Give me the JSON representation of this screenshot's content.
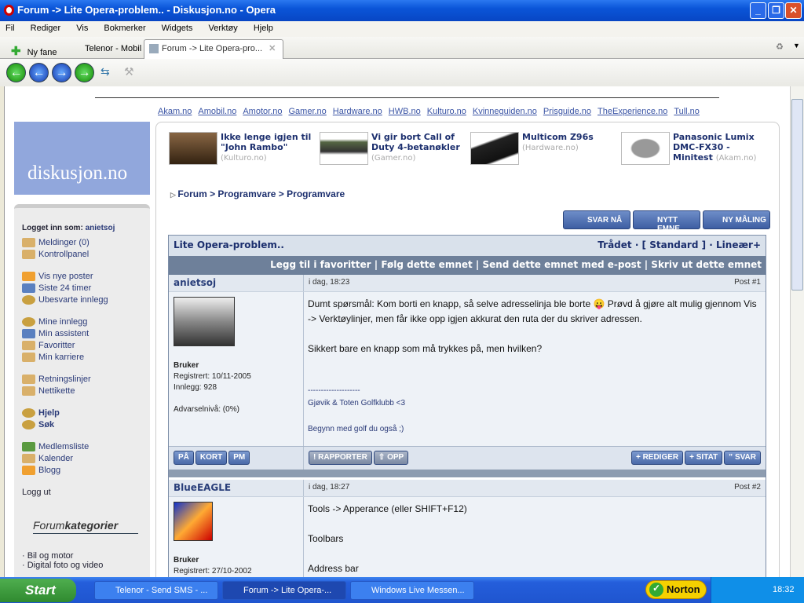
{
  "window": {
    "title": "Forum -> Lite Opera-problem.. - Diskusjon.no - Opera"
  },
  "menu": [
    "Fil",
    "Rediger",
    "Vis",
    "Bokmerker",
    "Widgets",
    "Verktøy",
    "Hjelp"
  ],
  "tabs": {
    "new_tab": "Ny fane",
    "tab1": "Telenor - Mobil",
    "tab2": "Forum -> Lite Opera-pro..."
  },
  "sitelinks": [
    "Akam.no",
    "Amobil.no",
    "Amotor.no",
    "Gamer.no",
    "Hardware.no",
    "HWB.no",
    "Kulturo.no",
    "Kvinneguiden.no",
    "Prisguide.no",
    "TheExperience.no",
    "Tull.no"
  ],
  "logo": "diskusjon.no",
  "news": [
    {
      "title": "Ikke lenge igjen til \"John Rambo\"",
      "source": "(Kulturo.no)"
    },
    {
      "title": "Vi gir bort Call of Duty 4-betanøkler",
      "source": "(Gamer.no)"
    },
    {
      "title": "Multicom Z96s",
      "source": "(Hardware.no)"
    },
    {
      "title": "Panasonic Lumix DMC-FX30 - Minitest",
      "source": "(Akam.no)"
    }
  ],
  "sidebar": {
    "logged_in_label": "Logget inn som:",
    "user": "anietsoj",
    "groups": [
      [
        {
          "label": "Meldinger (0)",
          "icon": "folder",
          "color": "#d9b06a"
        },
        {
          "label": "Kontrollpanel",
          "icon": "folder",
          "color": "#d9b06a"
        }
      ],
      [
        {
          "label": "Vis nye poster",
          "icon": "envelope",
          "color": "#f0a030"
        },
        {
          "label": "Siste 24 timer",
          "icon": "calendar",
          "color": "#5a80c0"
        },
        {
          "label": "Ubesvarte innlegg",
          "icon": "search",
          "color": "#c9a040"
        }
      ],
      [
        {
          "label": "Mine innlegg",
          "icon": "search",
          "color": "#c9a040"
        },
        {
          "label": "Min assistent",
          "icon": "calendar",
          "color": "#5a80c0"
        },
        {
          "label": "Favoritter",
          "icon": "folder",
          "color": "#d9b06a"
        },
        {
          "label": "Min karriere",
          "icon": "folder",
          "color": "#d9b06a"
        }
      ],
      [
        {
          "label": "Retningslinjer",
          "icon": "folder",
          "color": "#d9b06a"
        },
        {
          "label": "Nettikette",
          "icon": "folder",
          "color": "#d9b06a"
        }
      ],
      [
        {
          "label": "Hjelp",
          "icon": "search",
          "color": "#c9a040"
        },
        {
          "label": "Søk",
          "icon": "search",
          "color": "#c9a040"
        }
      ],
      [
        {
          "label": "Medlemsliste",
          "icon": "users",
          "color": "#5a9a40"
        },
        {
          "label": "Kalender",
          "icon": "folder",
          "color": "#d9b06a"
        },
        {
          "label": "Blogg",
          "icon": "envelope",
          "color": "#f0a030"
        }
      ]
    ],
    "logout": "Logg ut",
    "categories_title_a": "Forum",
    "categories_title_b": "kategorier",
    "categories": [
      "· Bil og motor",
      "· Digital foto og video"
    ]
  },
  "breadcrumb": "Forum > Programvare > Programvare",
  "thread_buttons": [
    "SVAR NÅ",
    "NYTT EMNE",
    "NY MÅLING"
  ],
  "thread": {
    "title": "Lite Opera-problem..",
    "modes": "Trådet · [ Standard ] · Lineær+",
    "actions": "Legg til i favoritter | Følg dette emnet | Send dette emnet med e-post | Skriv ut dette emnet",
    "posts": [
      {
        "author": "anietsoj",
        "time": "i dag, 18:23",
        "num": "Post #1",
        "rank": "Bruker",
        "registered": "Registrert: 10/11-2005",
        "posts": "Innlegg: 928",
        "warn": "Advarselnivå: (0%)",
        "body1": "Dumt spørsmål: Kom borti en knapp, så selve adresselinja ble borte 😛 Prøvd å gjøre alt mulig gjennom Vis -> Verktøylinjer, men får ikke opp igjen akkurat den ruta der du skriver adressen.",
        "body2": "Sikkert bare en knapp som må trykkes på, men hvilken?",
        "sig_line": "--------------------",
        "sig1": "Gjøvik & Toten Golfklubb <3",
        "sig2": "Begynn med golf du også ;)"
      },
      {
        "author": "BlueEAGLE",
        "time": "i dag, 18:27",
        "num": "Post #2",
        "rank": "Bruker",
        "registered": "Registrert: 27/10-2002",
        "body1": "Tools -> Apperance (eller SHIFT+F12)",
        "body2": "Toolbars",
        "body3": "Address bar"
      }
    ],
    "left_buttons": [
      "PÅ",
      "KORT",
      "PM"
    ],
    "mid_buttons": [
      "! RAPPORTER",
      "⇧ OPP"
    ],
    "right_buttons": [
      "+ REDIGER",
      "+   SITAT",
      "” SVAR"
    ]
  },
  "taskbar": {
    "start": "Start",
    "tasks": [
      "Telenor - Send SMS - ...",
      "Forum -> Lite Opera-...",
      "Windows Live Messen..."
    ],
    "norton": "Norton",
    "clock": "18:32"
  }
}
